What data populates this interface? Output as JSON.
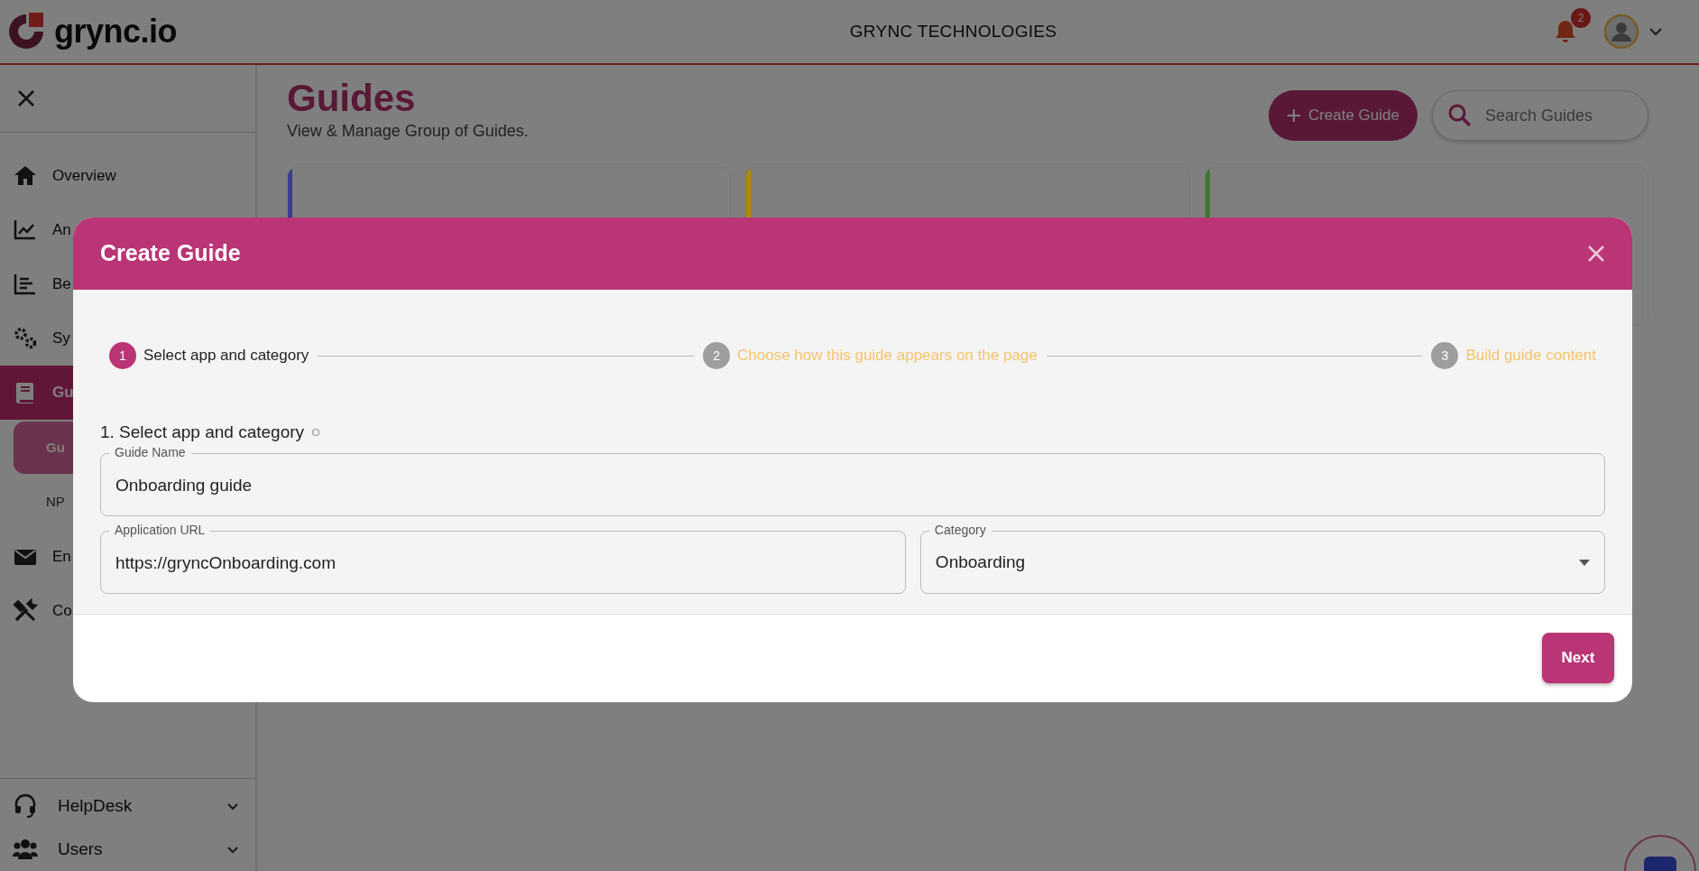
{
  "header": {
    "logo": "grync.io",
    "company": "GRYNC TECHNOLOGIES",
    "notification_count": "2"
  },
  "sidebar": {
    "items": [
      {
        "label": "Overview",
        "kind": "item",
        "selected": false
      },
      {
        "label": "An",
        "kind": "item",
        "selected": false
      },
      {
        "label": "Be",
        "kind": "item",
        "selected": false
      },
      {
        "label": "Sy",
        "kind": "item",
        "selected": false
      },
      {
        "label": "Gu",
        "kind": "item",
        "selected": true
      },
      {
        "label": "Gu",
        "kind": "subitem",
        "selected": true
      },
      {
        "label": "NP",
        "kind": "subitem",
        "selected": false
      },
      {
        "label": "En",
        "kind": "item",
        "selected": false
      },
      {
        "label": "Co",
        "kind": "item",
        "selected": false
      }
    ],
    "bottom_items": [
      {
        "label": "HelpDesk",
        "expanded": false
      },
      {
        "label": "Users",
        "expanded": false
      }
    ]
  },
  "main": {
    "title": "Guides",
    "subtitle": "View & Manage Group of Guides.",
    "create_button": "Create Guide",
    "search": {
      "placeholder": "Search Guides"
    },
    "cards": [
      {
        "color": "#3d3d8c"
      },
      {
        "color": "#b38600"
      },
      {
        "color": "#3b7a2e"
      }
    ]
  },
  "modal": {
    "title": "Create Guide",
    "steps": [
      {
        "number": "1",
        "label": "Select app and category",
        "selected": true
      },
      {
        "number": "2",
        "label": "Choose how this guide appears on the page",
        "selected": false
      },
      {
        "number": "3",
        "label": "Build guide content",
        "selected": false
      }
    ],
    "section_title": "1. Select app and category",
    "guide_name": {
      "label": "Guide Name",
      "value": "Onboarding guide"
    },
    "application_url": {
      "label": "Application URL",
      "value": "https://gryncOnboarding.com"
    },
    "category": {
      "label": "Category",
      "value": "Onboarding"
    },
    "next_button": "Next"
  }
}
